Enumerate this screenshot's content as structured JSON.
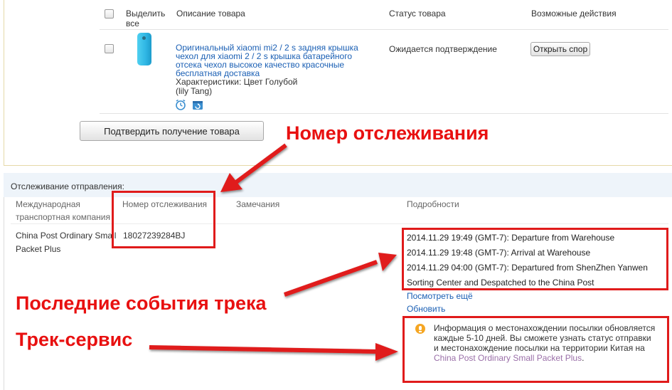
{
  "order": {
    "columns": {
      "select_all": "Выделить все",
      "description": "Описание товара",
      "status": "Статус товара",
      "actions": "Возможные действия"
    },
    "item": {
      "title_lines": [
        "Оригинальный xiaomi mi2 / 2 s задняя крышка",
        "чехол для xiaomi 2 / 2 s крышка батарейного",
        "отсека чехол высокое качество красочные",
        "бесплатная доставка"
      ],
      "attributes": "Характеристики: Цвет Голубой",
      "seller": "(lily Tang)",
      "status": "Ожидается подтверждение",
      "action_button": "Открыть спор"
    },
    "confirm_button": "Подтвердить получение товара"
  },
  "tracking": {
    "title": "Отслеживание отправления:",
    "columns": {
      "carrier": "Международная транспортная компания",
      "tracking_number": "Номер отслеживания",
      "remarks": "Замечания",
      "details": "Подробности"
    },
    "carrier": "China Post Ordinary Small Packet Plus",
    "tracking_number": "18027239284BJ",
    "events": [
      "2014.11.29 19:49 (GMT-7): Departure from Warehouse",
      "2014.11.29 19:48 (GMT-7): Arrival at Warehouse",
      "2014.11.29 04:00 (GMT-7): Departured from ShenZhen Yanwen",
      "Sorting Center and Despatched to the China Post"
    ],
    "see_more": "Посмотреть ещё",
    "refresh": "Обновить",
    "info_text": "Информация о местонахождении посылки обновляется каждые 5-10 дней. Вы сможете узнать статус отправки и местонахождение посылки на территории Китая на",
    "info_link": "China Post Ordinary Small Packet Plus",
    "info_end": "."
  },
  "annotations": {
    "tracking_number": "Номер отслеживания",
    "recent_events": "Последние события трека",
    "track_service": "Трек-сервис"
  },
  "colors": {
    "annotation_red": "#e01b1b",
    "link_blue": "#1a5fb4",
    "info_orange": "#f5a623"
  }
}
